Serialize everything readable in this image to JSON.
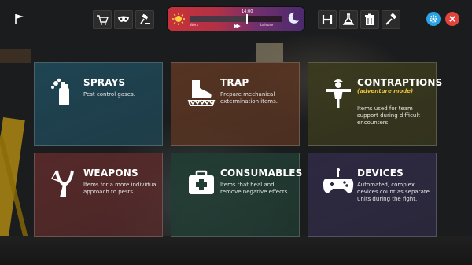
{
  "topbar": {
    "left_icons": [
      "flag-icon",
      "shop-cart-icon",
      "mask-icon",
      "gavel-icon"
    ],
    "right_icons": [
      "h-icon",
      "flask-icon",
      "trash-icon",
      "hammer-icon"
    ],
    "settings_icon": "gear-icon",
    "close_icon": "close-icon",
    "time_label": "14:00",
    "work_label": "Work",
    "leisure_label": "Leisure",
    "fast_forward_symbol": "▶▶",
    "colors": {
      "settings": "#29a3e4",
      "close": "#e0443c"
    }
  },
  "categories": [
    {
      "key": "sprays",
      "title": "SPRAYS",
      "subtitle": "",
      "description": "Pest control gases.",
      "icon": "spray-can-icon",
      "color": "#1f4756"
    },
    {
      "key": "trap",
      "title": "TRAP",
      "subtitle": "",
      "description": "Prepare mechanical extermination items.",
      "icon": "boot-trap-icon",
      "color": "#5a3522"
    },
    {
      "key": "contraptions",
      "title": "CONTRAPTIONS",
      "subtitle": "(adventure mode)",
      "description": "Items used for team support during difficult encounters.",
      "icon": "scarecrow-icon",
      "color": "#3a3a1e"
    },
    {
      "key": "weapons",
      "title": "WEAPONS",
      "subtitle": "",
      "description": "Items for a more individual approach to pests.",
      "icon": "slingshot-icon",
      "color": "#5a2a2a"
    },
    {
      "key": "consumables",
      "title": "CONSUMABLES",
      "subtitle": "",
      "description": "Items that heal and remove negative effects.",
      "icon": "medkit-icon",
      "color": "#213c33"
    },
    {
      "key": "devices",
      "title": "DEVICES",
      "subtitle": "",
      "description": "Automated, complex devices count as separate units during the fight.",
      "icon": "gamepad-icon",
      "color": "#2f2a44"
    }
  ]
}
